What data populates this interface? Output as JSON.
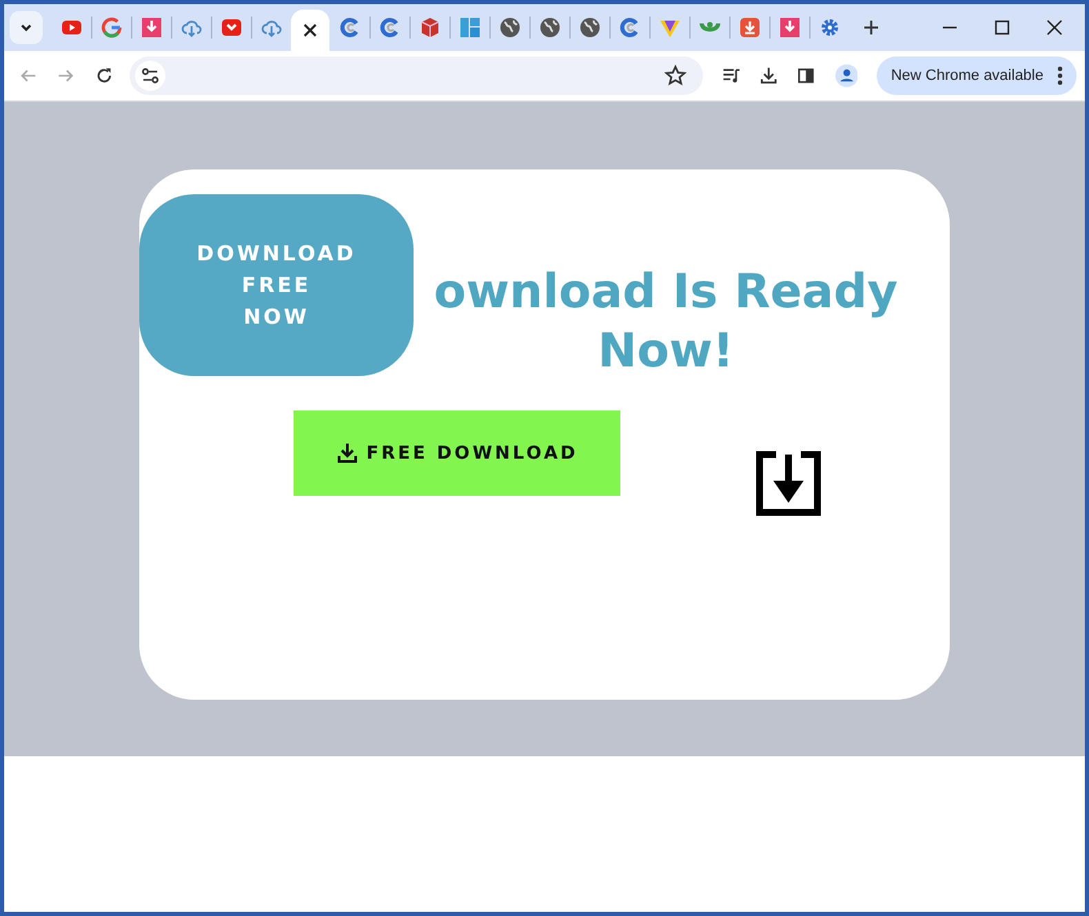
{
  "tabs": [
    {
      "kind": "video",
      "selected": false
    },
    {
      "kind": "multicolor-g",
      "selected": false
    },
    {
      "kind": "pink-download",
      "selected": false
    },
    {
      "kind": "cloud",
      "selected": false
    },
    {
      "kind": "red-download",
      "selected": false
    },
    {
      "kind": "cloud",
      "selected": false
    },
    {
      "kind": "blank",
      "selected": true
    },
    {
      "kind": "swirl",
      "selected": false
    },
    {
      "kind": "swirl",
      "selected": false
    },
    {
      "kind": "cube",
      "selected": false
    },
    {
      "kind": "squares",
      "selected": false
    },
    {
      "kind": "globe",
      "selected": false
    },
    {
      "kind": "globe",
      "selected": false
    },
    {
      "kind": "globe",
      "selected": false
    },
    {
      "kind": "swirl",
      "selected": false
    },
    {
      "kind": "v-shape",
      "selected": false
    },
    {
      "kind": "green",
      "selected": false
    },
    {
      "kind": "orange-download",
      "selected": false
    },
    {
      "kind": "pink-download",
      "selected": false
    },
    {
      "kind": "gear",
      "selected": false
    }
  ],
  "toolbar": {
    "update_button": "New Chrome available"
  },
  "page": {
    "badge": "DOWNLOAD FREE NOW",
    "heading": "ownload Is Ready Now!",
    "download_button": "FREE DOWNLOAD"
  }
}
